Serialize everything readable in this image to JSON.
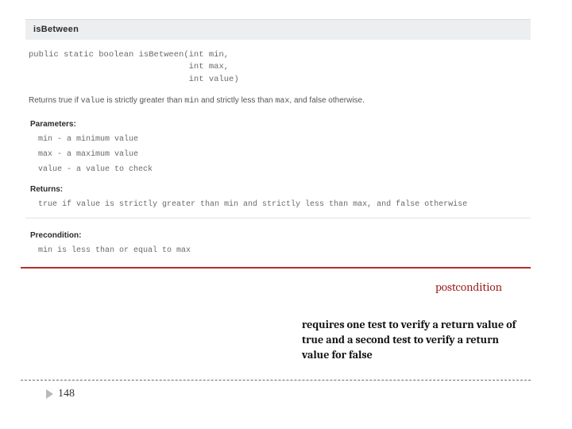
{
  "doc": {
    "method_name": "isBetween",
    "signature": "public static boolean isBetween(int min,\n                                int max,\n                                int value)",
    "description_prefix": "Returns true if ",
    "description_code1": "value",
    "description_mid1": " is strictly greater than ",
    "description_code2": "min",
    "description_mid2": " and strictly less than ",
    "description_code3": "max",
    "description_suffix": ", and false otherwise.",
    "parameters_label": "Parameters:",
    "params": {
      "p0": "min - a minimum value",
      "p1": "max - a maximum value",
      "p2": "value - a value to check"
    },
    "returns_label": "Returns:",
    "returns_text": "true if value is strictly greater than min and strictly less than max, and false otherwise",
    "precondition_label": "Precondition:",
    "precondition_text": "min is less than or equal to max"
  },
  "annot": {
    "label": "postcondition",
    "note": "requires one test to verify a return value of true and a second test to verify a return value for false"
  },
  "page": {
    "number": "148"
  }
}
